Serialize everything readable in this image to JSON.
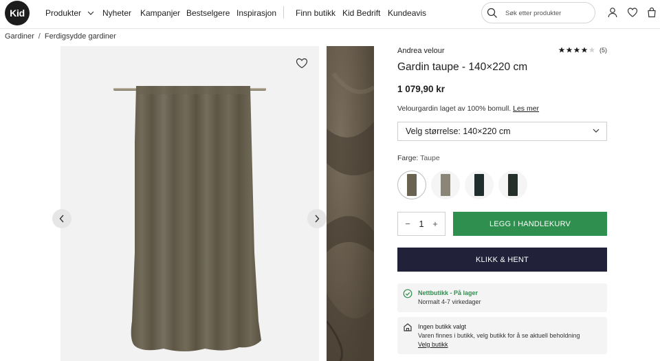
{
  "header": {
    "logo_text": "Kid",
    "nav": [
      "Produkter",
      "Nyheter",
      "Kampanjer",
      "Bestselgere",
      "Inspirasjon"
    ],
    "nav_secondary": [
      "Finn butikk",
      "Kid Bedrift",
      "Kundeavis"
    ],
    "search_placeholder": "Søk etter produkter",
    "icons": [
      "search-icon",
      "user-icon",
      "heart-icon",
      "bag-icon"
    ]
  },
  "breadcrumb": [
    "Gardiner",
    "Ferdigsydde gardiner"
  ],
  "product": {
    "brand": "Andrea velour",
    "rating": 4,
    "rating_max": 5,
    "review_count": "(5)",
    "title": "Gardin taupe - 140×220 cm",
    "price": "1 079,90 kr",
    "description": "Velourgardin laget av 100% bomull.",
    "read_more": "Les mer",
    "size_select": "Velg størrelse: 140×220 cm",
    "color_label": "Farge:",
    "color_value": "Taupe",
    "swatches": [
      {
        "name": "Taupe",
        "color": "#6b6352",
        "selected": true
      },
      {
        "name": "Grå",
        "color": "#8a8577",
        "selected": false
      },
      {
        "name": "Mørk grønn",
        "color": "#1f2e2c",
        "selected": false
      },
      {
        "name": "Grønn",
        "color": "#25302a",
        "selected": false
      }
    ],
    "quantity": "1",
    "add_to_cart": "LEGG I HANDLEKURV",
    "click_collect": "KLIKK & HENT",
    "stock_title": "Nettbutikk - På lager",
    "stock_sub": "Normalt 4-7 virkedager",
    "store_title": "Ingen butikk valgt",
    "store_sub": "Varen finnes i butikk, velg butikk for å se aktuell beholdning",
    "store_link": "Velg butikk"
  },
  "colors": {
    "accent_green": "#2f8f4e",
    "dark_navy": "#22213a"
  }
}
